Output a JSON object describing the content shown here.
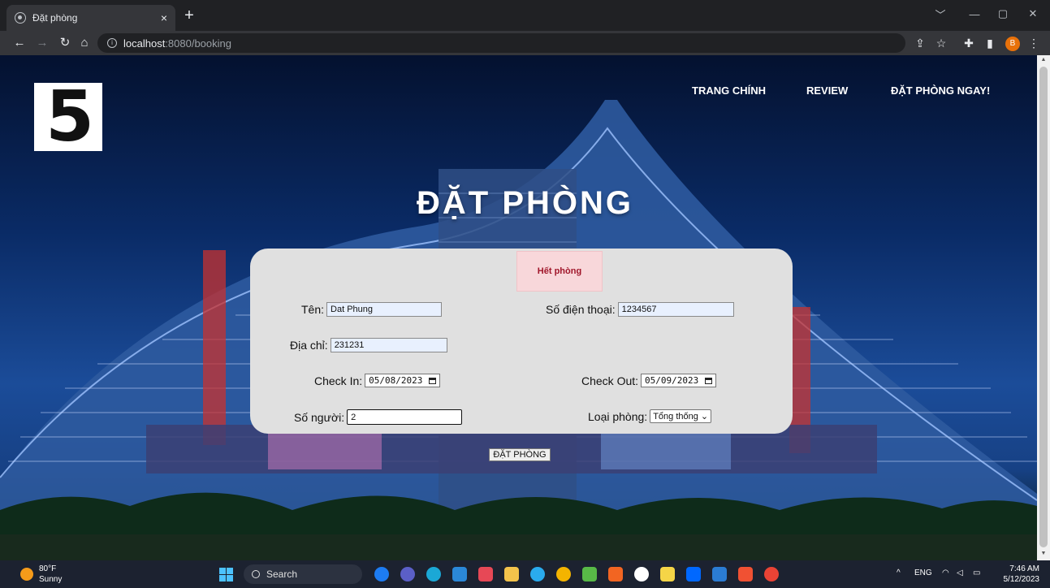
{
  "browser": {
    "tab_title": "Đặt phòng",
    "tab_close": "×",
    "new_tab": "+",
    "url_host": "localhost",
    "url_path": ":8080/booking",
    "profile_initial": "B",
    "window_controls": [
      "﹀",
      "—",
      "▢",
      "✕"
    ]
  },
  "site": {
    "logo": "5",
    "nav": [
      "TRANG CHÍNH",
      "REVIEW",
      "ĐẶT PHÒNG NGAY!"
    ],
    "heading": "ĐẶT PHÒNG",
    "alert": "Hết phòng"
  },
  "form": {
    "name_label": "Tên:",
    "name_value": "Dat Phung",
    "phone_label": "Số điện thoại:",
    "phone_value": "1234567",
    "address_label": "Địa chỉ:",
    "address_value": "231231",
    "checkin_label": "Check In:",
    "checkin_value": "05/08/2023",
    "checkout_label": "Check Out:",
    "checkout_value": "05/09/2023",
    "guests_label": "Số người:",
    "guests_value": "2",
    "roomtype_label": "Loại phòng:",
    "roomtype_value": "Tổng thống",
    "submit_label": "ĐẶT PHÒNG"
  },
  "taskbar": {
    "temperature": "80°F",
    "condition": "Sunny",
    "search_label": "Search",
    "language": "ENG",
    "time": "7:46 AM",
    "date": "5/12/2023",
    "apps": [
      "bing",
      "meet",
      "edge",
      "mail",
      "store",
      "explorer",
      "telegram",
      "chrome",
      "vpn",
      "office",
      "steam",
      "notes",
      "zalo",
      "word",
      "git",
      "chrome-profile"
    ],
    "app_colors": [
      "#1d7cf2",
      "#5b5fc7",
      "#1ba8d6",
      "#2b88d8",
      "#e74856",
      "#f3c34b",
      "#2aabee",
      "#f4b400",
      "#58b947",
      "#f26522",
      "#ffffff",
      "#f5d547",
      "#0068ff",
      "#2b7cd3",
      "#f05133",
      "#ea4335"
    ]
  }
}
